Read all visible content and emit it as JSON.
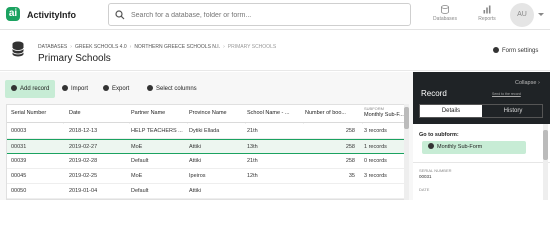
{
  "app": {
    "logo_text": "ActivityInfo",
    "logo_letter": "ai"
  },
  "search": {
    "placeholder": "Search for a database, folder or form..."
  },
  "nav": {
    "databases": "Databases",
    "reports": "Reports"
  },
  "user": {
    "initials": "AU"
  },
  "breadcrumb": [
    "DATABASES",
    "GREEK SCHOOLS 4.0",
    "NORTHERN GREECE SCHOOLS N.I.",
    "PRIMARY SCHOOLS"
  ],
  "page_title": "Primary Schools",
  "form_settings": "Form settings",
  "toolbar": {
    "add": "Add record",
    "import": "Import",
    "export": "Export",
    "select_columns": "Select columns"
  },
  "table": {
    "headers": [
      "Serial Number",
      "Date",
      "Partner Name",
      "Province Name",
      "School Name - ...",
      "Number of boo...",
      "Monthly Sub-F..."
    ],
    "subheader": "SUBFORM",
    "rows": [
      [
        "00003",
        "2018-12-13",
        "HELP TEACHERS ...",
        "Dytiki Ellada",
        "21th",
        "258",
        "3 records"
      ],
      [
        "00031",
        "2019-02-27",
        "MoE",
        "Attiki",
        "13th",
        "258",
        "1 records"
      ],
      [
        "00039",
        "2019-02-28",
        "Default",
        "Attiki",
        "21th",
        "258",
        "0 records"
      ],
      [
        "00045",
        "2019-02-25",
        "MoE",
        "Ipeiros",
        "12th",
        "35",
        "3 records"
      ],
      [
        "00050",
        "2019-01-04",
        "Default",
        "Attiki",
        "",
        "",
        ""
      ]
    ],
    "selected_row": 1
  },
  "panel": {
    "collapse": "Collapse",
    "title": "Record",
    "send_link": "Send to the record",
    "tabs": [
      "Details",
      "History"
    ],
    "goto_label": "Go to subform:",
    "subform_button": "Monthly Sub-Form",
    "fields": [
      {
        "label": "SERIAL NUMBER",
        "value": "00031"
      },
      {
        "label": "DATE",
        "value": ""
      }
    ]
  },
  "colors": {
    "accent": "#1ba260",
    "accent_light": "#c7ecd5",
    "panel_bg": "#1f2326"
  }
}
